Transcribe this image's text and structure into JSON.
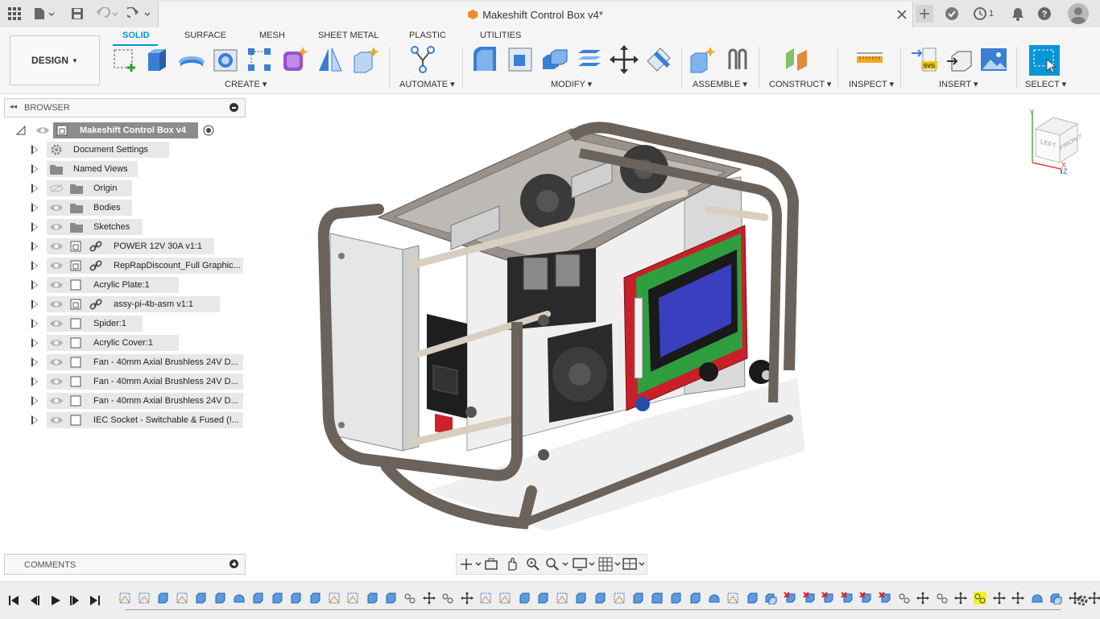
{
  "titlebar": {
    "document_title": "Makeshift Control Box v4*",
    "job_count": "1"
  },
  "toolbar": {
    "workspace_button": "DESIGN",
    "tabs": [
      {
        "label": "SOLID",
        "active": true
      },
      {
        "label": "SURFACE"
      },
      {
        "label": "MESH"
      },
      {
        "label": "SHEET METAL"
      },
      {
        "label": "PLASTIC"
      },
      {
        "label": "UTILITIES"
      }
    ],
    "groups": {
      "create": "CREATE",
      "automate": "AUTOMATE",
      "modify": "MODIFY",
      "assemble": "ASSEMBLE",
      "construct": "CONSTRUCT",
      "inspect": "INSPECT",
      "insert": "INSERT",
      "select": "SELECT"
    }
  },
  "browser": {
    "header": "BROWSER",
    "root": "Makeshift Control Box v4",
    "items": [
      {
        "label": "Document Settings",
        "icon": "gear-icon"
      },
      {
        "label": "Named Views",
        "icon": "folder-icon"
      },
      {
        "label": "Origin",
        "icon": "folder-icon",
        "hidden": true
      },
      {
        "label": "Bodies",
        "icon": "folder-icon"
      },
      {
        "label": "Sketches",
        "icon": "folder-icon"
      },
      {
        "label": "POWER 12V 30A v1:1",
        "icon": "linked-component-icon"
      },
      {
        "label": "RepRapDiscount_Full Graphic...",
        "icon": "linked-component-icon"
      },
      {
        "label": "Acrylic Plate:1",
        "icon": "component-icon"
      },
      {
        "label": "assy-pi-4b-asm v1:1",
        "icon": "linked-component-icon"
      },
      {
        "label": "Spider:1",
        "icon": "component-icon"
      },
      {
        "label": "Acrylic Cover:1",
        "icon": "component-icon"
      },
      {
        "label": "Fan - 40mm Axial Brushless 24V D...",
        "icon": "component-icon"
      },
      {
        "label": "Fan - 40mm Axial Brushless 24V D...",
        "icon": "component-icon"
      },
      {
        "label": "Fan - 40mm Axial Brushless 24V D...",
        "icon": "component-icon"
      },
      {
        "label": "IEC Socket - Switchable & Fused (!...",
        "icon": "component-icon"
      }
    ]
  },
  "comments": {
    "header": "COMMENTS"
  },
  "viewcube": {
    "left": "LEFT",
    "front": "FRONT",
    "axis_x": "X",
    "axis_y": "Y",
    "axis_z": "Z"
  },
  "colors": {
    "accent": "#0696d7",
    "frame": "#6b625c",
    "pcb_red": "#c8202a",
    "lcd_blue": "#3a3fc0"
  }
}
